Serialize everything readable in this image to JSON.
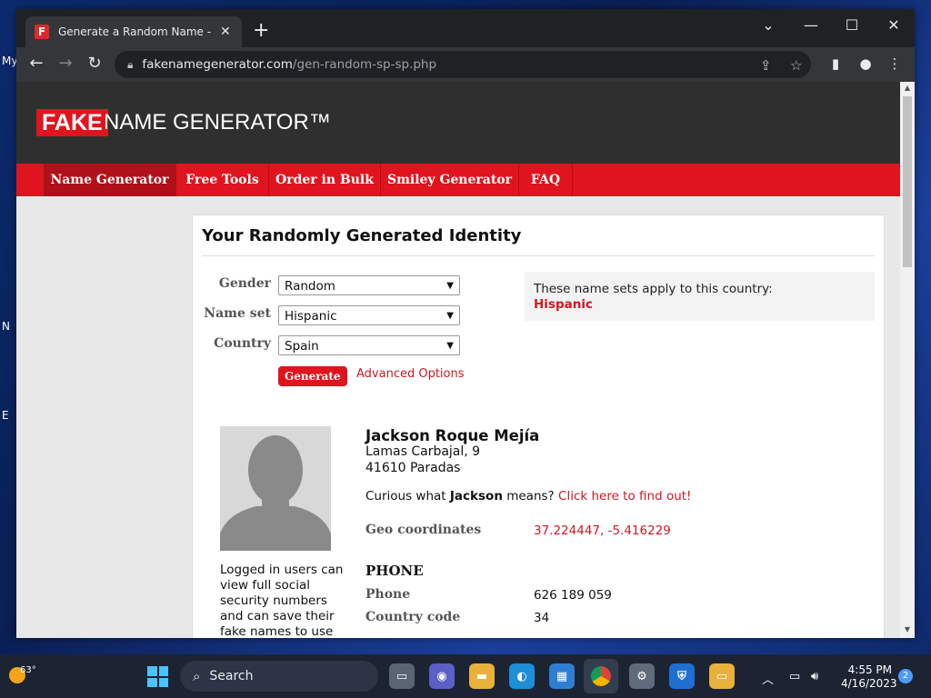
{
  "desktop": {
    "edge_labels": [
      "My",
      "N",
      "E"
    ]
  },
  "browser": {
    "tab_title": "Generate a Random Name - Ran",
    "tab_favicon": "F",
    "url_host": "fakenamegenerator.com",
    "url_path": "/gen-random-sp-sp.php"
  },
  "site": {
    "logo_box": "FAKE",
    "logo_rest": "NAME GENERATOR™",
    "nav": [
      "Name Generator",
      "Free Tools",
      "Order in Bulk",
      "Smiley Generator",
      "FAQ"
    ]
  },
  "page": {
    "title": "Your Randomly Generated Identity",
    "form": {
      "gender_label": "Gender",
      "gender_value": "Random",
      "nameset_label": "Name set",
      "nameset_value": "Hispanic",
      "country_label": "Country",
      "country_value": "Spain",
      "generate_label": "Generate",
      "advanced_label": "Advanced Options"
    },
    "namesets_info": {
      "text": "These name sets apply to this country:",
      "value": "Hispanic"
    },
    "identity": {
      "name": "Jackson Roque Mejía",
      "address_line1": "Lamas Carbajal, 9",
      "address_line2": "41610 Paradas",
      "curious_pre": "Curious what ",
      "curious_name": "Jackson",
      "curious_post": " means? ",
      "curious_link": "Click here to find out!",
      "geo_label": "Geo coordinates",
      "geo_value": "37.224447, -5.416229",
      "phone_heading": "PHONE",
      "phone_label": "Phone",
      "phone_value": "626 189 059",
      "country_code_label": "Country code",
      "country_code_value": "34"
    },
    "login_note": "Logged in users can view full social security numbers and can save their fake names to use later."
  },
  "taskbar": {
    "temperature": "63°",
    "search_label": "Search",
    "time": "4:55 PM",
    "date": "4/16/2023",
    "notifications": "2"
  },
  "colors": {
    "brand_red": "#e0141e",
    "link_red": "#d01820",
    "header_dark": "#2f2f2f"
  }
}
